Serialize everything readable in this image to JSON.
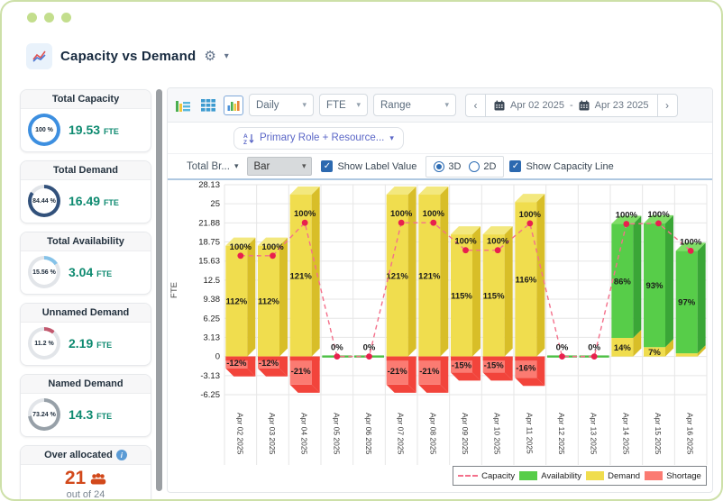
{
  "header": {
    "title": "Capacity vs Demand"
  },
  "sidebar": {
    "cards": [
      {
        "title": "Total Capacity",
        "percent": "100 %",
        "pct": 100,
        "ring_color": "#3D8FE0",
        "value": "19.53",
        "unit": "FTE"
      },
      {
        "title": "Total Demand",
        "percent": "84.44 %",
        "pct": 84.44,
        "ring_color": "#32517B",
        "value": "16.49",
        "unit": "FTE"
      },
      {
        "title": "Total Availability",
        "percent": "15.56 %",
        "pct": 15.56,
        "ring_color": "#85C2E8",
        "value": "3.04",
        "unit": "FTE"
      },
      {
        "title": "Unnamed Demand",
        "percent": "11.2 %",
        "pct": 11.2,
        "ring_color": "#C2586E",
        "value": "2.19",
        "unit": "FTE"
      },
      {
        "title": "Named Demand",
        "percent": "73.24 %",
        "pct": 73.24,
        "ring_color": "#97A0A8",
        "value": "14.3",
        "unit": "FTE"
      }
    ],
    "over_allocated": {
      "title": "Over allocated",
      "count": "21",
      "caption": "out of 24"
    }
  },
  "toolbar": {
    "granularity": "Daily",
    "unit": "FTE",
    "mode": "Range",
    "date_from": "Apr 02 2025",
    "date_sep": "-",
    "date_to": "Apr 23 2025"
  },
  "filters": {
    "grouping": "Primary Role + Resource...",
    "breakdown": "Total Br...",
    "chart_type": "Bar",
    "show_label_value": "Show Label Value",
    "dim_3d": "3D",
    "dim_2d": "2D",
    "show_capacity_line": "Show Capacity Line"
  },
  "chart_data": {
    "type": "bar",
    "ylabel": "FTE",
    "ylim": [
      -6.25,
      28.125
    ],
    "yticks": [
      "28.13",
      "25",
      "21.88",
      "18.75",
      "15.63",
      "12.5",
      "9.38",
      "6.25",
      "3.13",
      "0",
      "-3.13",
      "-6.25"
    ],
    "grid": true,
    "legend_position": "bottom-right",
    "colors": {
      "demand": "#F0DD4E",
      "demand_side": "#D8BE28",
      "demand_top": "#F3E87E",
      "availability": "#57CD49",
      "availability_side": "#3AA637",
      "availability_top": "#7FDD66",
      "shortage": "#FB7B72",
      "shortage_dark": "#F2443B",
      "capacity_line": "#F4708B",
      "capacity_dot": "#E8204E",
      "zero_avail_line": "#4CBF44"
    },
    "legend": [
      {
        "label": "Capacity",
        "swatch": "dashed-line",
        "color": "#F4708B"
      },
      {
        "label": "Availability",
        "swatch": "box",
        "color": "#57CD49"
      },
      {
        "label": "Demand",
        "swatch": "box",
        "color": "#F0DD4E"
      },
      {
        "label": "Shortage",
        "swatch": "box",
        "color": "#FB7B72"
      }
    ],
    "days": [
      {
        "date": "Apr 02 2025",
        "capacity_fte": 16.5,
        "capacity_label": "100%",
        "demand_fte": 18.14,
        "demand_label": "112%",
        "shortage_fte": -1.94,
        "shortage_label": "-12%",
        "availability_fte": 0,
        "availability_label": ""
      },
      {
        "date": "Apr 03 2025",
        "capacity_fte": 16.5,
        "capacity_label": "100%",
        "demand_fte": 18.14,
        "demand_label": "112%",
        "shortage_fte": -1.94,
        "shortage_label": "-12%",
        "availability_fte": 0,
        "availability_label": ""
      },
      {
        "date": "Apr 04 2025",
        "capacity_fte": 21.9,
        "capacity_label": "100%",
        "demand_fte": 26.5,
        "demand_label": "121%",
        "shortage_fte": -4.6,
        "shortage_label": "-21%",
        "availability_fte": 0,
        "availability_label": ""
      },
      {
        "date": "Apr 05 2025",
        "capacity_fte": 0,
        "capacity_label": "0%",
        "demand_fte": 0,
        "demand_label": "",
        "shortage_fte": 0,
        "shortage_label": "",
        "availability_fte": 0,
        "availability_label": ""
      },
      {
        "date": "Apr 06 2025",
        "capacity_fte": 0,
        "capacity_label": "0%",
        "demand_fte": 0,
        "demand_label": "",
        "shortage_fte": 0,
        "shortage_label": "",
        "availability_fte": 0,
        "availability_label": ""
      },
      {
        "date": "Apr 07 2025",
        "capacity_fte": 21.9,
        "capacity_label": "100%",
        "demand_fte": 26.5,
        "demand_label": "121%",
        "shortage_fte": -4.6,
        "shortage_label": "-21%",
        "availability_fte": 0,
        "availability_label": ""
      },
      {
        "date": "Apr 08 2025",
        "capacity_fte": 21.9,
        "capacity_label": "100%",
        "demand_fte": 26.5,
        "demand_label": "121%",
        "shortage_fte": -4.6,
        "shortage_label": "-21%",
        "availability_fte": 0,
        "availability_label": ""
      },
      {
        "date": "Apr 09 2025",
        "capacity_fte": 17.4,
        "capacity_label": "100%",
        "demand_fte": 20.0,
        "demand_label": "115%",
        "shortage_fte": -2.61,
        "shortage_label": "-15%",
        "availability_fte": 0,
        "availability_label": ""
      },
      {
        "date": "Apr 10 2025",
        "capacity_fte": 17.4,
        "capacity_label": "100%",
        "demand_fte": 20.0,
        "demand_label": "115%",
        "shortage_fte": -2.61,
        "shortage_label": "-15%",
        "availability_fte": 0,
        "availability_label": ""
      },
      {
        "date": "Apr 11 2025",
        "capacity_fte": 21.8,
        "capacity_label": "100%",
        "demand_fte": 25.3,
        "demand_label": "116%",
        "shortage_fte": -3.49,
        "shortage_label": "-16%",
        "availability_fte": 0,
        "availability_label": ""
      },
      {
        "date": "Apr 12 2025",
        "capacity_fte": 0,
        "capacity_label": "0%",
        "demand_fte": 0,
        "demand_label": "",
        "shortage_fte": 0,
        "shortage_label": "",
        "availability_fte": 0,
        "availability_label": ""
      },
      {
        "date": "Apr 13 2025",
        "capacity_fte": 0,
        "capacity_label": "0%",
        "demand_fte": 0,
        "demand_label": "",
        "shortage_fte": 0,
        "shortage_label": "",
        "availability_fte": 0,
        "availability_label": ""
      },
      {
        "date": "Apr 14 2025",
        "capacity_fte": 21.7,
        "capacity_label": "100%",
        "demand_fte": 3.04,
        "demand_label": "14%",
        "shortage_fte": 0,
        "shortage_label": "",
        "availability_fte": 18.66,
        "availability_label": "86%"
      },
      {
        "date": "Apr 15 2025",
        "capacity_fte": 21.8,
        "capacity_label": "100%",
        "demand_fte": 1.53,
        "demand_label": "7%",
        "shortage_fte": 0,
        "shortage_label": "",
        "availability_fte": 20.27,
        "availability_label": "93%"
      },
      {
        "date": "Apr 16 2025",
        "capacity_fte": 17.3,
        "capacity_label": "100%",
        "demand_fte": 0.52,
        "demand_label": "",
        "shortage_fte": 0,
        "shortage_label": "",
        "availability_fte": 16.78,
        "availability_label": "97%"
      }
    ]
  }
}
